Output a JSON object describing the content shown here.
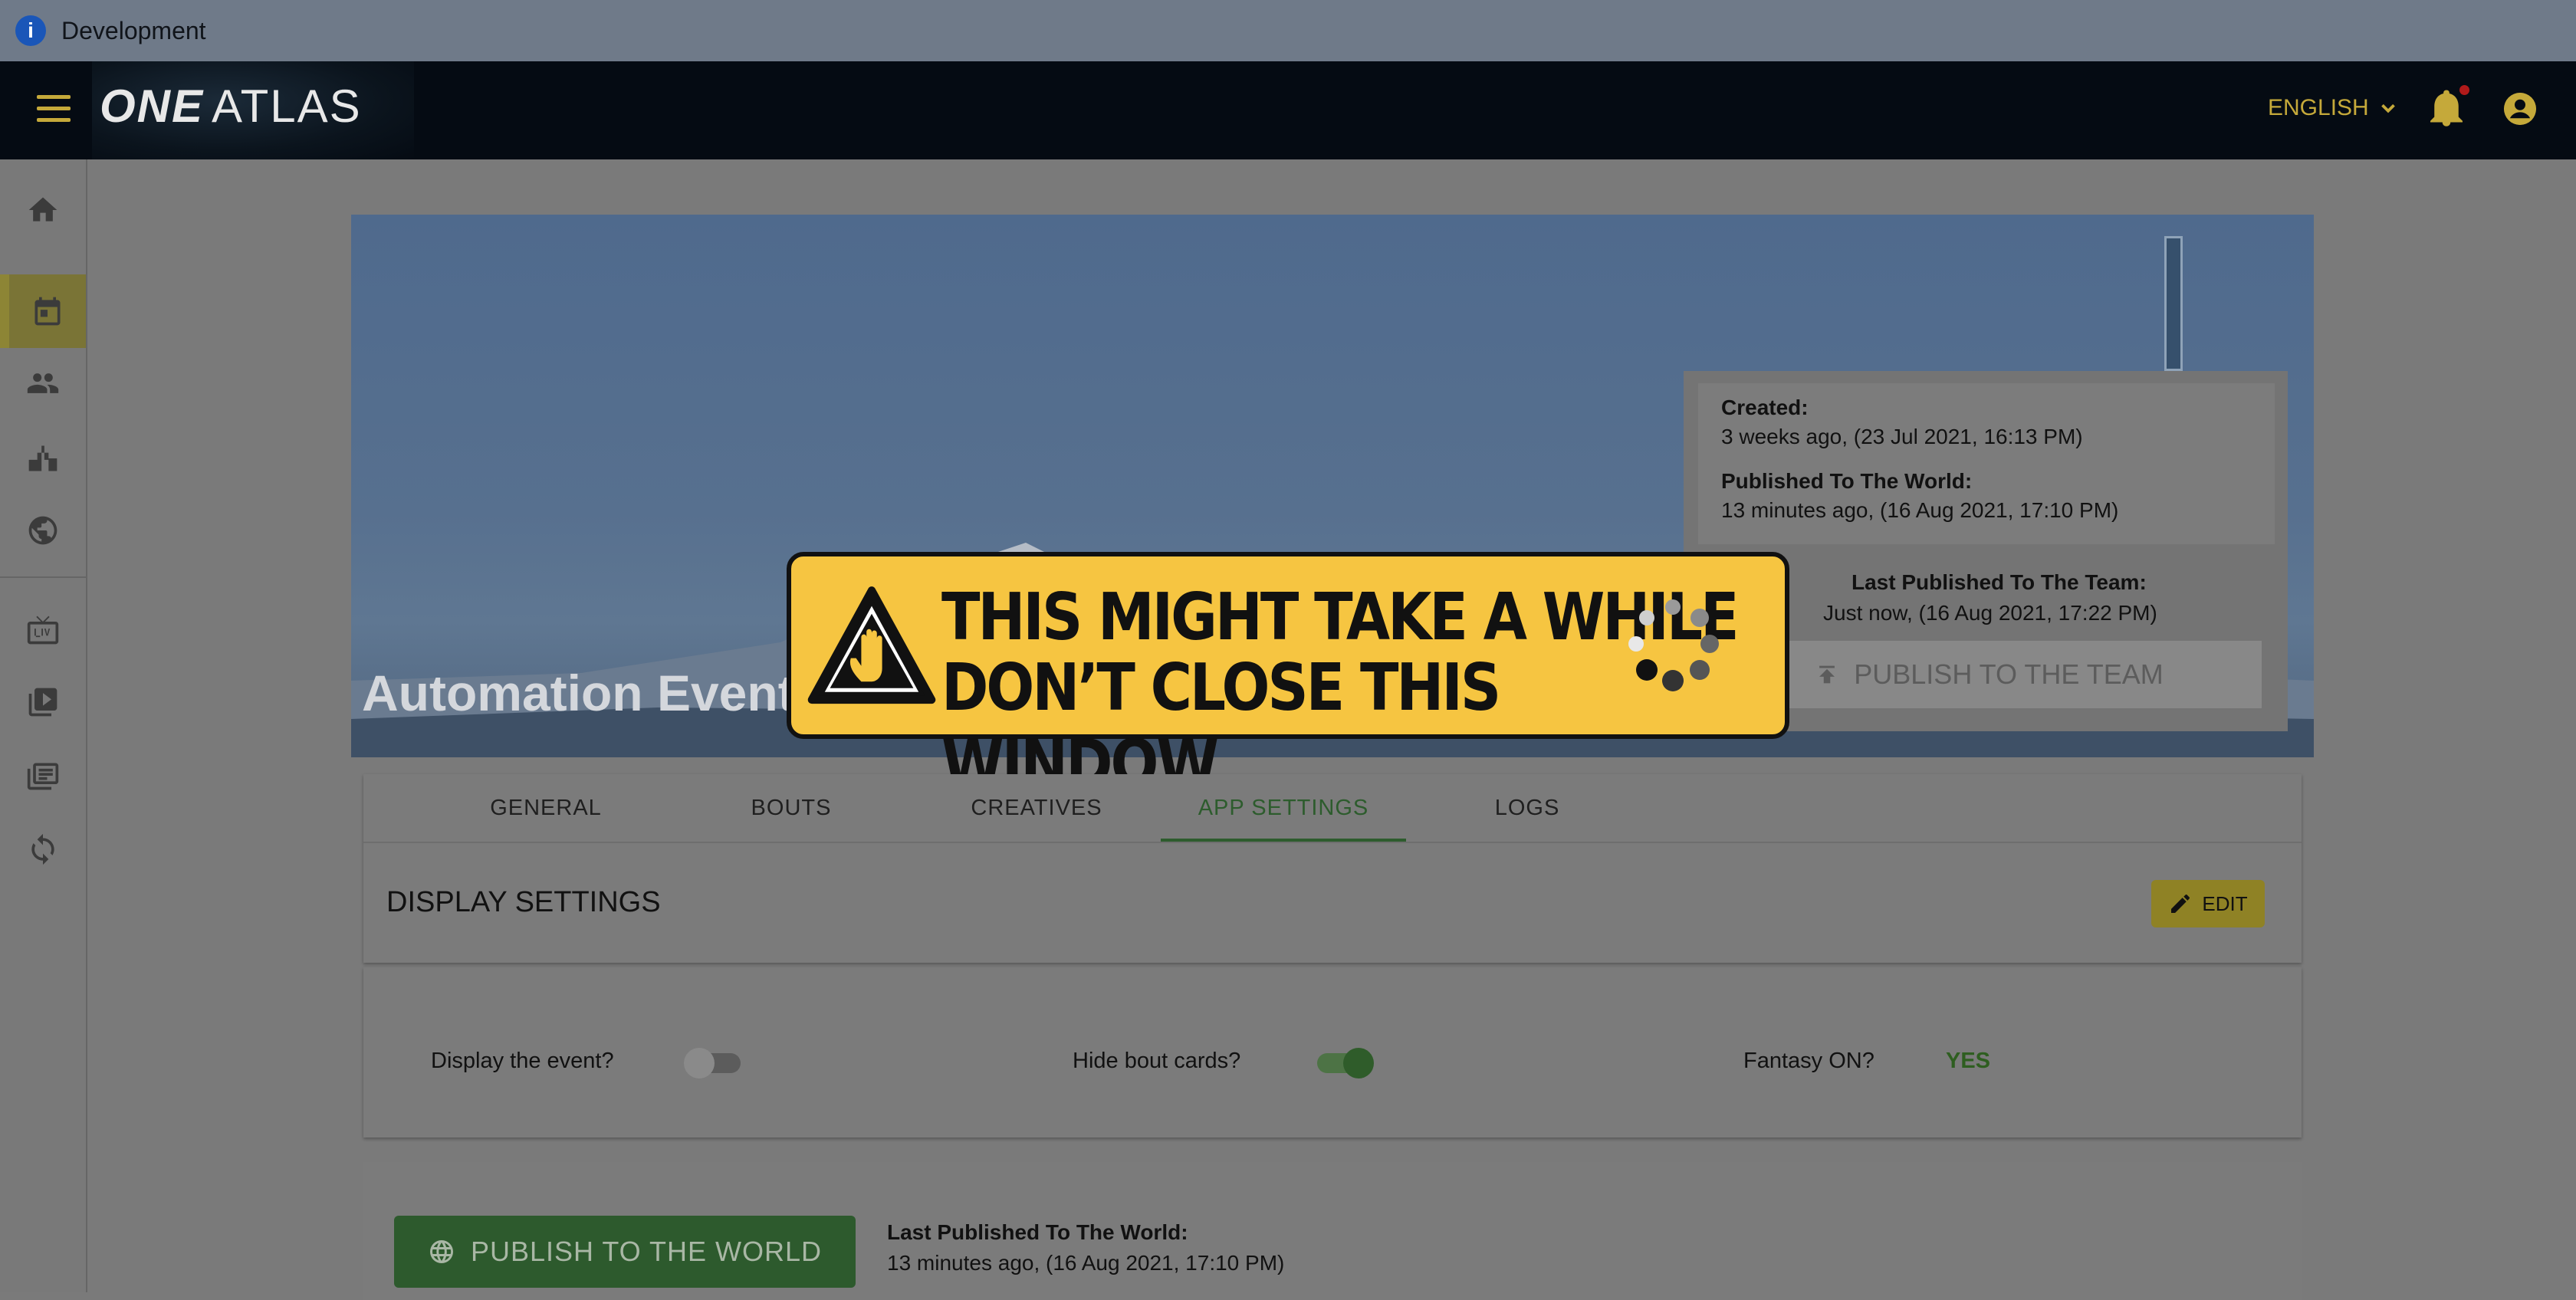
{
  "dev_banner": {
    "icon": "info-icon",
    "text": "Development"
  },
  "appbar": {
    "logo_bold": "ONE",
    "logo_light": "ATLAS",
    "language": "ENGLISH",
    "accent_color": "#c5a93a"
  },
  "sidebar": {
    "items": [
      {
        "icon": "home-icon"
      },
      {
        "icon": "calendar-icon",
        "active": true
      },
      {
        "icon": "people-icon"
      },
      {
        "icon": "podium-icon"
      },
      {
        "icon": "globe-icon"
      },
      {
        "icon": "live-tv-icon"
      },
      {
        "icon": "video-library-icon"
      },
      {
        "icon": "collections-icon"
      },
      {
        "icon": "sync-icon"
      }
    ]
  },
  "hero": {
    "event_title": "Automation Event",
    "created_label": "Created:",
    "created_value": "3 weeks ago, (23 Jul 2021, 16:13 PM)",
    "published_world_label": "Published To The World:",
    "published_world_value": "13 minutes ago, (16 Aug 2021, 17:10 PM)",
    "team_label": "Last Published To The Team:",
    "team_value": "Just now, (16 Aug 2021, 17:22 PM)",
    "team_button": "PUBLISH TO THE TEAM"
  },
  "warning": {
    "line1": "THIS MIGHT TAKE A WHILE",
    "line2": "DON’T CLOSE THIS WINDOW",
    "color": "#f6c541"
  },
  "tabs": [
    {
      "label": "GENERAL"
    },
    {
      "label": "BOUTS"
    },
    {
      "label": "CREATIVES"
    },
    {
      "label": "APP SETTINGS",
      "active": true
    },
    {
      "label": "LOGS"
    }
  ],
  "display_settings": {
    "title": "DISPLAY SETTINGS",
    "edit_label": "EDIT",
    "display_event_label": "Display the event?",
    "display_event_on": false,
    "hide_bout_cards_label": "Hide bout cards?",
    "hide_bout_cards_on": true,
    "fantasy_label": "Fantasy ON?",
    "fantasy_value": "YES"
  },
  "publish": {
    "world_button": "PUBLISH TO THE WORLD",
    "world_label": "Last Published To The World:",
    "world_value": "13 minutes ago, (16 Aug 2021, 17:10 PM)"
  }
}
